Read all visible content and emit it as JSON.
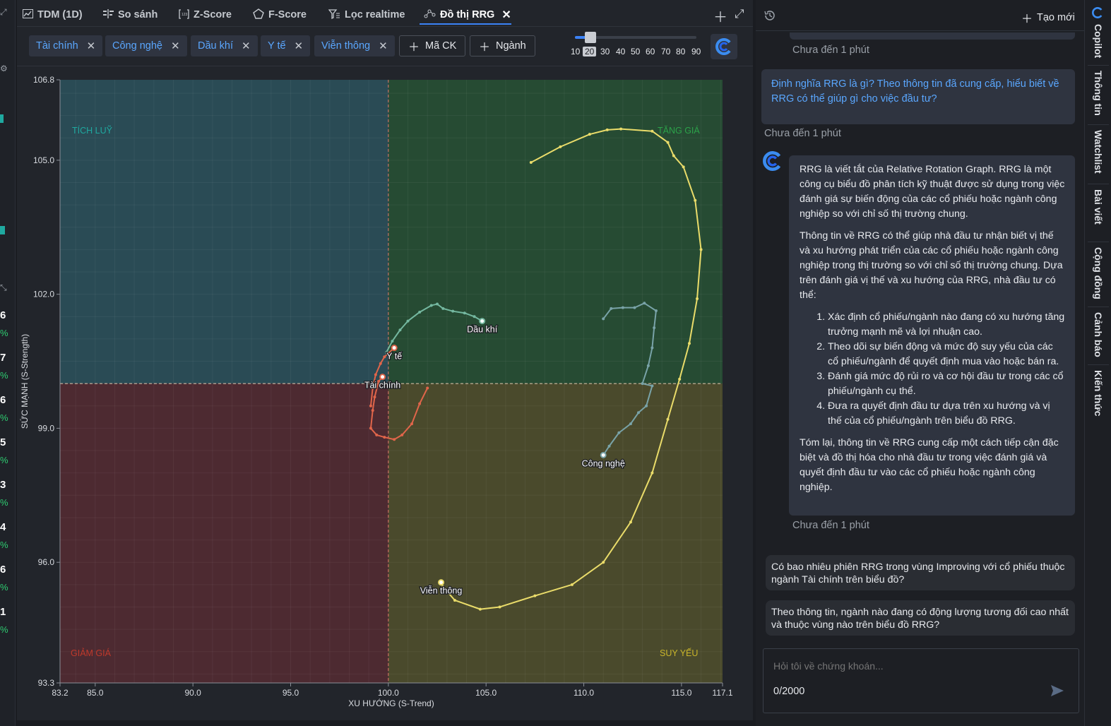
{
  "tabs": [
    {
      "label": "TDM (1D)",
      "icon": "chart-icon"
    },
    {
      "label": "So sánh",
      "icon": "compare-icon"
    },
    {
      "label": "Z-Score",
      "icon": "zscore-icon"
    },
    {
      "label": "F-Score",
      "icon": "pentagon-icon"
    },
    {
      "label": "Lọc realtime",
      "icon": "filter-icon"
    },
    {
      "label": "Đồ thị RRG",
      "icon": "rrg-icon",
      "active": true
    }
  ],
  "filters": {
    "chips": [
      "Tài chính",
      "Công nghệ",
      "Dầu khí",
      "Y tế",
      "Viễn thông"
    ],
    "add_stock_label": "Mã CK",
    "add_sector_label": "Ngành",
    "period_options": [
      "10",
      "20",
      "30",
      "40",
      "50",
      "60",
      "70",
      "80",
      "90"
    ],
    "period_selected": "20"
  },
  "chart_data": {
    "type": "scatter",
    "xlabel": "XU HƯỚNG (S-Trend)",
    "ylabel": "SỨC MẠNH (S-Strength)",
    "xlim": [
      83.2,
      117.1
    ],
    "ylim": [
      93.3,
      106.8
    ],
    "xticks": [
      "83.2",
      "85.0",
      "90.0",
      "95.0",
      "100.0",
      "105.0",
      "110.0",
      "115.0",
      "117.1"
    ],
    "yticks": [
      "93.3",
      "96.0",
      "99.0",
      "102.0",
      "105.0",
      "106.8"
    ],
    "center": [
      100,
      100
    ],
    "quadrants": {
      "top_left": {
        "label": "TÍCH LUỸ",
        "color": "#2a4b55",
        "label_color": "#1fa9a0"
      },
      "top_right": {
        "label": "TĂNG GIÁ",
        "color": "#264b33",
        "label_color": "#2ca24a"
      },
      "bottom_left": {
        "label": "GIẢM GIÁ",
        "color": "#4d2a31",
        "label_color": "#c0392b"
      },
      "bottom_right": {
        "label": "SUY YẾU",
        "color": "#4a4a2c",
        "label_color": "#c9b52a"
      }
    },
    "series": [
      {
        "name": "Dầu khí",
        "color": "#74b8a0",
        "points": [
          [
            99.9,
            100.7
          ],
          [
            100.2,
            100.95
          ],
          [
            100.6,
            101.2
          ],
          [
            101.0,
            101.4
          ],
          [
            101.6,
            101.6
          ],
          [
            102.2,
            101.75
          ],
          [
            102.5,
            101.78
          ],
          [
            102.8,
            101.68
          ],
          [
            103.3,
            101.62
          ],
          [
            103.9,
            101.58
          ],
          [
            104.4,
            101.5
          ],
          [
            104.8,
            101.4
          ]
        ]
      },
      {
        "name": "Y tế",
        "color": "#e0654a",
        "points": [
          [
            99.1,
            99.5
          ],
          [
            99.2,
            99.9
          ],
          [
            99.35,
            100.2
          ],
          [
            99.6,
            100.45
          ],
          [
            99.8,
            100.6
          ],
          [
            100.3,
            100.8
          ]
        ]
      },
      {
        "name": "Tài chính",
        "color": "#e0654a",
        "points": [
          [
            102.0,
            99.9
          ],
          [
            101.6,
            99.55
          ],
          [
            101.2,
            99.1
          ],
          [
            100.7,
            98.85
          ],
          [
            100.3,
            98.75
          ],
          [
            99.8,
            98.8
          ],
          [
            99.4,
            98.85
          ],
          [
            99.1,
            99.0
          ],
          [
            99.2,
            99.4
          ],
          [
            99.3,
            99.7
          ],
          [
            99.5,
            100.05
          ],
          [
            99.7,
            100.15
          ]
        ]
      },
      {
        "name": "Công nghệ",
        "color": "#79a3a8",
        "points": [
          [
            111.0,
            101.45
          ],
          [
            111.4,
            101.68
          ],
          [
            112.0,
            101.7
          ],
          [
            112.6,
            101.7
          ],
          [
            113.1,
            101.8
          ],
          [
            113.7,
            101.63
          ],
          [
            113.6,
            101.25
          ],
          [
            113.5,
            100.8
          ],
          [
            113.3,
            100.4
          ],
          [
            113.0,
            100.0
          ],
          [
            113.5,
            99.95
          ],
          [
            113.2,
            99.5
          ],
          [
            112.8,
            99.35
          ],
          [
            112.4,
            99.1
          ],
          [
            111.8,
            98.9
          ],
          [
            111.3,
            98.6
          ],
          [
            111.0,
            98.4
          ]
        ]
      },
      {
        "name": "Viễn thông",
        "color": "#eadc6a",
        "points": [
          [
            107.3,
            104.95
          ],
          [
            108.8,
            105.3
          ],
          [
            110.3,
            105.58
          ],
          [
            111.2,
            105.68
          ],
          [
            111.9,
            105.7
          ],
          [
            113.5,
            105.65
          ],
          [
            114.3,
            105.4
          ],
          [
            114.6,
            105.1
          ],
          [
            115.1,
            104.85
          ],
          [
            115.7,
            104.1
          ],
          [
            116.0,
            103.0
          ],
          [
            115.8,
            101.9
          ],
          [
            115.4,
            100.9
          ],
          [
            114.9,
            100.1
          ],
          [
            114.3,
            99.2
          ],
          [
            113.5,
            98.0
          ],
          [
            112.4,
            96.9
          ],
          [
            111.0,
            96.0
          ],
          [
            109.4,
            95.5
          ],
          [
            107.5,
            95.25
          ],
          [
            105.7,
            95.0
          ],
          [
            104.7,
            94.95
          ],
          [
            103.4,
            95.15
          ],
          [
            102.8,
            95.45
          ],
          [
            102.7,
            95.55
          ]
        ]
      }
    ]
  },
  "right_panel": {
    "new_label": "Tạo mới",
    "timestamp": "Chưa đến 1 phút",
    "user_question": "Định nghĩa RRG là gì? Theo thông tin đã cung cấp, hiểu biết về RRG có thể giúp gì cho việc đầu tư?",
    "ai_answer": {
      "p1": "RRG là viết tắt của Relative Rotation Graph. RRG là một công cụ biểu đồ phân tích kỹ thuật được sử dụng trong việc đánh giá sự biến động của các cổ phiếu hoặc ngành công nghiệp so với chỉ số thị trường chung.",
      "p2": "Thông tin về RRG có thể giúp nhà đầu tư nhận biết vị thế và xu hướng phát triển của các cổ phiếu hoặc ngành công nghiệp trong thị trường so với chỉ số thị trường chung. Dựa trên đánh giá vị thế và xu hướng của RRG, nhà đầu tư có thể:",
      "items": [
        "Xác định cổ phiếu/ngành nào đang có xu hướng tăng trưởng mạnh mẽ và lợi nhuận cao.",
        "Theo dõi sự biến động và mức độ suy yếu của các cổ phiếu/ngành để quyết định mua vào hoặc bán ra.",
        "Đánh giá mức độ rủi ro và cơ hội đầu tư trong các cổ phiếu/ngành cụ thể.",
        "Đưa ra quyết định đầu tư dựa trên xu hướng và vị thế của cổ phiếu/ngành trên biểu đồ RRG."
      ],
      "p3": "Tóm lại, thông tin về RRG cung cấp một cách tiếp cận đặc biệt và đồ thị hóa cho nhà đầu tư trong việc đánh giá và quyết định đầu tư vào các cổ phiếu hoặc ngành công nghiệp."
    },
    "suggestions": [
      "Có bao nhiêu phiên RRG trong vùng Improving với cổ phiếu thuộc ngành Tài chính trên biểu đồ?",
      "Theo thông tin, ngành nào đang có động lượng tương đối cao nhất và thuộc vùng nào trên biểu đồ RRG?"
    ],
    "input_placeholder": "Hỏi tôi về chứng khoán...",
    "char_count": "0/2000"
  },
  "vertical_tabs": [
    "Copilot",
    "Thông tin",
    "Watchlist",
    "Bài viết",
    "Cộng đồng",
    "Cảnh báo",
    "Kiến thức"
  ],
  "left_strip": {
    "numbers": [
      "6",
      "7",
      "6",
      "5",
      "3",
      "4",
      "6",
      "1"
    ],
    "pct": "%"
  }
}
